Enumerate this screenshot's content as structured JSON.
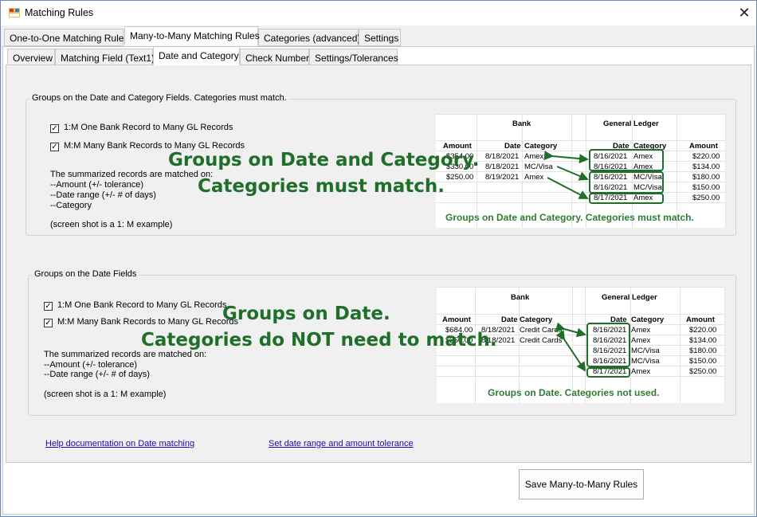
{
  "window": {
    "title": "Matching Rules",
    "close_glyph": "✕"
  },
  "tabs_top": [
    "One-to-One Matching Rules",
    "Many-to-Many Matching Rules",
    "Categories (advanced)",
    "Settings"
  ],
  "tabs_sub": [
    "Overview",
    "Matching Field (Text1)",
    "Date and Category",
    "Check Number",
    "Settings/Tolerances"
  ],
  "section1": {
    "legend": "Groups on the Date and Category Fields. Categories must match.",
    "checkbox_1m": "1:M One Bank Record to Many GL Records",
    "checkbox_mm": "M:M Many Bank Records to Many GL Records",
    "check_glyph": "✓",
    "desc_lines": [
      "The summarized records are matched on:",
      "--Amount (+/- tolerance)",
      "--Date range (+/- # of days)",
      "--Category"
    ],
    "note": "(screen shot is a 1: M example)",
    "overlay_line1": "Groups on Date and Category.",
    "overlay_line2": "Categories must match.",
    "sheet": {
      "bank_header": "Bank",
      "gl_header": "General Ledger",
      "col_amount": "Amount",
      "col_date": "Date",
      "col_category": "Category",
      "bank_rows": [
        {
          "amount": "$354.00",
          "date": "8/18/2021",
          "category": "Amex"
        },
        {
          "amount": "$330.00",
          "date": "8/18/2021",
          "category": "MC/Visa"
        },
        {
          "amount": "$250.00",
          "date": "8/19/2021",
          "category": "Amex"
        }
      ],
      "gl_rows": [
        {
          "date": "8/16/2021",
          "category": "Amex",
          "amount": "$220.00"
        },
        {
          "date": "8/16/2021",
          "category": "Amex",
          "amount": "$134.00"
        },
        {
          "date": "8/16/2021",
          "category": "MC/Visa",
          "amount": "$180.00"
        },
        {
          "date": "8/16/2021",
          "category": "MC/Visa",
          "amount": "$150.00"
        },
        {
          "date": "8/17/2021",
          "category": "Amex",
          "amount": "$250.00"
        }
      ],
      "caption": "Groups on Date and Category. Categories must match."
    }
  },
  "section2": {
    "legend": "Groups on the Date Fields",
    "checkbox_1m": "1:M One Bank Record to Many GL Records",
    "checkbox_mm": "M:M Many Bank Records to Many GL Records",
    "check_glyph": "✓",
    "desc_lines": [
      "The summarized records are matched on:",
      "--Amount (+/- tolerance)",
      "--Date range (+/- # of days)"
    ],
    "note": "(screen shot is a 1: M example)",
    "overlay_line1": "Groups on Date.",
    "overlay_line2": "Categories do NOT need to match.",
    "sheet": {
      "bank_header": "Bank",
      "gl_header": "General Ledger",
      "col_amount": "Amount",
      "col_date": "Date",
      "col_category": "Category",
      "bank_rows": [
        {
          "amount": "$684.00",
          "date": "8/18/2021",
          "category": "Credit Cards"
        },
        {
          "amount": "$250.00",
          "date": "8/18/2021",
          "category": "Credit Cards"
        }
      ],
      "gl_rows": [
        {
          "date": "8/16/2021",
          "category": "Amex",
          "amount": "$220.00"
        },
        {
          "date": "8/16/2021",
          "category": "Amex",
          "amount": "$134.00"
        },
        {
          "date": "8/16/2021",
          "category": "MC/Visa",
          "amount": "$180.00"
        },
        {
          "date": "8/16/2021",
          "category": "MC/Visa",
          "amount": "$150.00"
        },
        {
          "date": "8/17/2021",
          "category": "Amex",
          "amount": "$250.00"
        }
      ],
      "caption": "Groups on Date. Categories not used."
    }
  },
  "links": {
    "help": "Help documentation on Date matching",
    "tolerance": "Set date range and amount tolerance"
  },
  "save_button": "Save Many-to-Many Rules",
  "colors": {
    "overlay_green": "#1f6e2a",
    "link_blue": "#1a0dab"
  }
}
